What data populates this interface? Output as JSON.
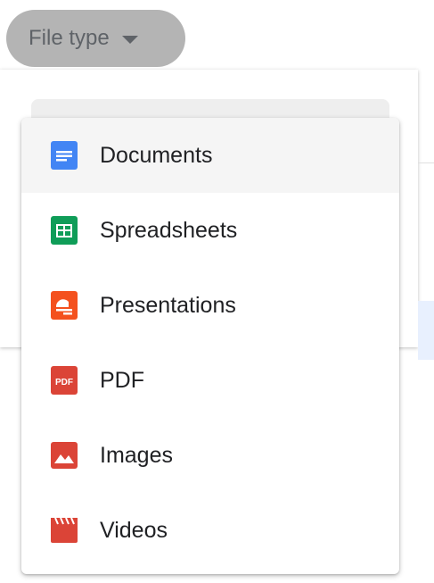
{
  "filter_chip": {
    "label": "File type",
    "icon": "caret-down-icon"
  },
  "menu": {
    "items": [
      {
        "label": "Documents",
        "icon": "google-docs-icon",
        "color": "#4285f4",
        "selected": true
      },
      {
        "label": "Spreadsheets",
        "icon": "google-sheets-icon",
        "color": "#0f9d58",
        "selected": false
      },
      {
        "label": "Presentations",
        "icon": "google-slides-icon",
        "color": "#f4511e",
        "selected": false
      },
      {
        "label": "PDF",
        "icon": "pdf-icon",
        "color": "#db4437",
        "selected": false
      },
      {
        "label": "Images",
        "icon": "image-icon",
        "color": "#db4437",
        "selected": false
      },
      {
        "label": "Videos",
        "icon": "video-icon",
        "color": "#db4437",
        "selected": false
      }
    ]
  },
  "colors": {
    "chip_background": "#b4b4b4",
    "chip_text": "#5f6368",
    "menu_text": "#202124",
    "selected_row": "#f5f5f5"
  }
}
